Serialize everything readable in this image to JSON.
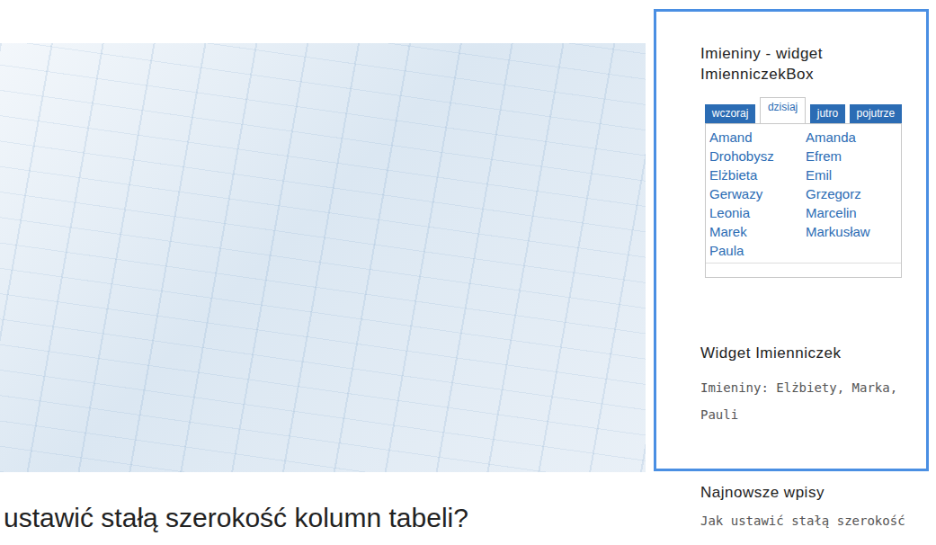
{
  "article": {
    "heading": "ustawić stałą szerokość kolumn tabeli?"
  },
  "sidebar": {
    "namedays_box": {
      "title": "Imieniny - widget ImienniczekBox",
      "tabs": [
        {
          "label": "wczoraj",
          "selected": false
        },
        {
          "label": "dzisiaj",
          "selected": true
        },
        {
          "label": "jutro",
          "selected": false
        },
        {
          "label": "pojutrze",
          "selected": false
        }
      ],
      "names": [
        "Amand",
        "Amanda",
        "Drohobysz",
        "Efrem",
        "Elżbieta",
        "Emil",
        "Gerwazy",
        "Grzegorz",
        "Leonia",
        "Marcelin",
        "Marek",
        "Markusław",
        "Paula"
      ]
    },
    "namedays_widget": {
      "title": "Widget Imienniczek",
      "text": "Imieniny: Elżbiety, Marka, Pauli"
    },
    "recent_posts": {
      "title": "Najnowsze wpisy",
      "items": [
        "Jak ustawić stałą szerokość"
      ]
    }
  }
}
